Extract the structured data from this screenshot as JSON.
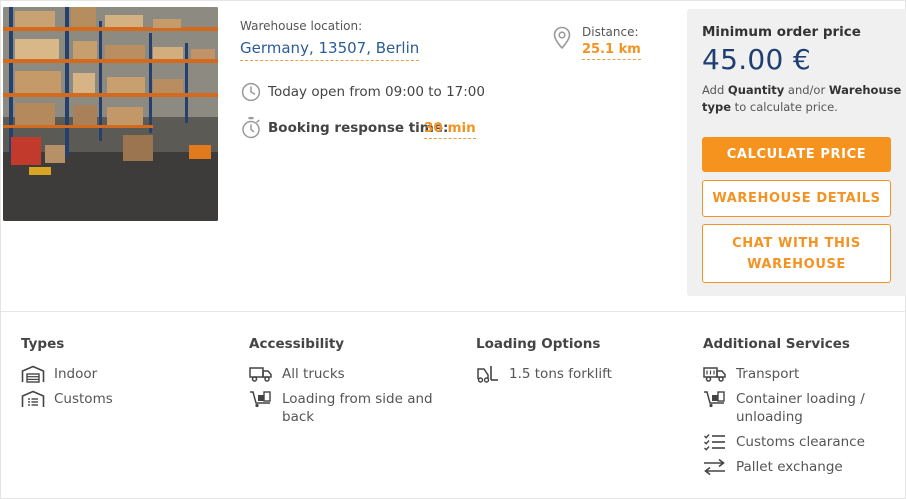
{
  "warehouse": {
    "location_label": "Warehouse location:",
    "location_value": "Germany, 13507, Berlin",
    "distance_label": "Distance:",
    "distance_value": "25.1 km",
    "opening_hours": "Today open from 09:00 to 17:00",
    "response_label": "Booking response time:",
    "response_value": "30 min"
  },
  "price_panel": {
    "label": "Minimum order price",
    "value": "45.00 €",
    "hint_prefix": "Add ",
    "hint_quantity": "Quantity",
    "hint_middle": " and/or ",
    "hint_type": "Warehouse type",
    "hint_suffix": " to calculate price.",
    "calculate_label": "CALCULATE PRICE",
    "details_label": "WAREHOUSE DETAILS",
    "chat_label": "CHAT WITH THIS WAREHOUSE"
  },
  "features": {
    "types": {
      "title": "Types",
      "items": [
        {
          "label": "Indoor",
          "icon": "warehouse-icon"
        },
        {
          "label": "Customs",
          "icon": "customs-warehouse-icon"
        }
      ]
    },
    "accessibility": {
      "title": "Accessibility",
      "items": [
        {
          "label": "All trucks",
          "icon": "truck-icon"
        },
        {
          "label": "Loading from side and back",
          "icon": "loading-icon"
        }
      ]
    },
    "loading_options": {
      "title": "Loading Options",
      "items": [
        {
          "label": "1.5 tons forklift",
          "icon": "forklift-icon"
        }
      ]
    },
    "additional_services": {
      "title": "Additional Services",
      "items": [
        {
          "label": "Transport",
          "icon": "truck-icon"
        },
        {
          "label": "Container loading / unloading",
          "icon": "loading-icon"
        },
        {
          "label": "Customs clearance",
          "icon": "checklist-icon"
        },
        {
          "label": "Pallet exchange",
          "icon": "exchange-arrows-icon"
        }
      ]
    }
  },
  "colors": {
    "accent": "#f6921e",
    "price": "#1f3f72",
    "link": "#2c5c95",
    "panel_bg": "#f0f0f0"
  }
}
